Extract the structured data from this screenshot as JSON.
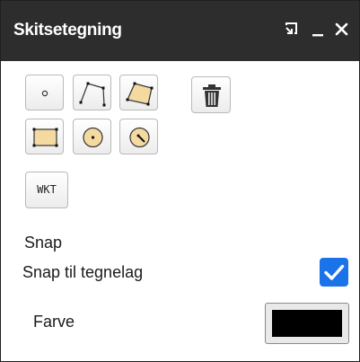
{
  "window": {
    "title": "Skitsetegning",
    "controls": [
      "dock-icon",
      "minimize-icon",
      "close-icon"
    ]
  },
  "tools": {
    "point": "point-icon",
    "line": "polyline-icon",
    "polygon": "polygon-icon",
    "delete": "trash-icon",
    "rectangle": "rectangle-icon",
    "circle": "circle-icon",
    "radius_circle": "radius-circle-icon",
    "wkt_label": "WKT"
  },
  "snap": {
    "heading": "Snap",
    "option_label": "Snap til tegnelag",
    "checked": true
  },
  "color": {
    "label": "Farve",
    "value": "#000000"
  },
  "colors": {
    "titlebar": "#2d2d2d",
    "accent": "#1a73e8",
    "shape_fill": "#f4d9a0"
  }
}
